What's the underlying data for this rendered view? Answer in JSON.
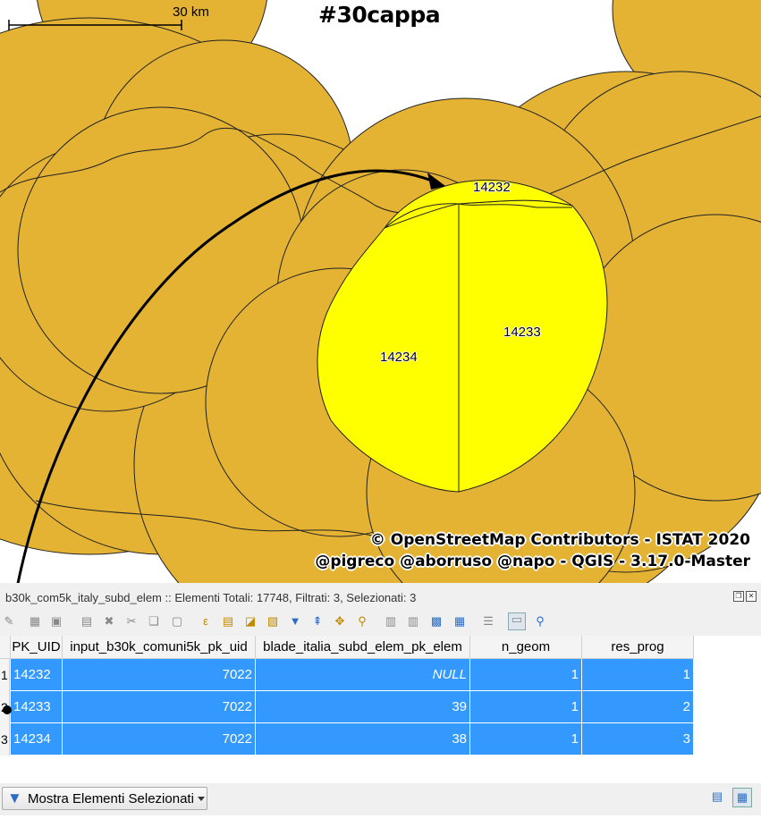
{
  "map": {
    "title": "#30cappa",
    "scale_label": "30 km",
    "credit_line1": "© OpenStreetMap Contributors - ISTAT 2020",
    "credit_line2": "@pigreco @aborruso @napo - QGIS - 3.17.0-Master",
    "polygon_labels": [
      "14232",
      "14233",
      "14234"
    ],
    "colors": {
      "circles": "#e4b334",
      "selected": "#ffff00",
      "background": "#ffffff"
    }
  },
  "attribute_table": {
    "title": "b30k_com5k_italy_subd_elem :: Elementi Totali: 17748, Filtrati: 3, Selezionati: 3",
    "columns": [
      "PK_UID",
      "input_b30k_comuni5k_pk_uid",
      "blade_italia_subd_elem_pk_elem",
      "n_geom",
      "res_prog"
    ],
    "rows": [
      {
        "num": "1",
        "cells": [
          "14232",
          "7022",
          "NULL",
          "1",
          "1"
        ]
      },
      {
        "num": "2",
        "cells": [
          "14233",
          "7022",
          "39",
          "1",
          "2"
        ]
      },
      {
        "num": "3",
        "cells": [
          "14234",
          "7022",
          "38",
          "1",
          "3"
        ]
      }
    ],
    "selection_color": "#3399ff",
    "toolbar_icons": [
      "edit-pencil-icon",
      "multi-edit-icon",
      "save-icon",
      "add-feature-icon",
      "delete-feature-icon",
      "cut-icon",
      "copy-icon",
      "paste-icon",
      "expression-select-icon",
      "select-all-icon",
      "invert-selection-icon",
      "deselect-icon",
      "filter-selection-icon",
      "move-selection-top-icon",
      "pan-to-selection-icon",
      "zoom-to-selection-icon",
      "new-field-icon",
      "delete-field-icon",
      "field-calculator-icon",
      "conditional-format-icon",
      "actions-icon",
      "dock-icon",
      "inspect-icon"
    ],
    "filter_button_label": "Mostra Elementi Selezionati"
  }
}
